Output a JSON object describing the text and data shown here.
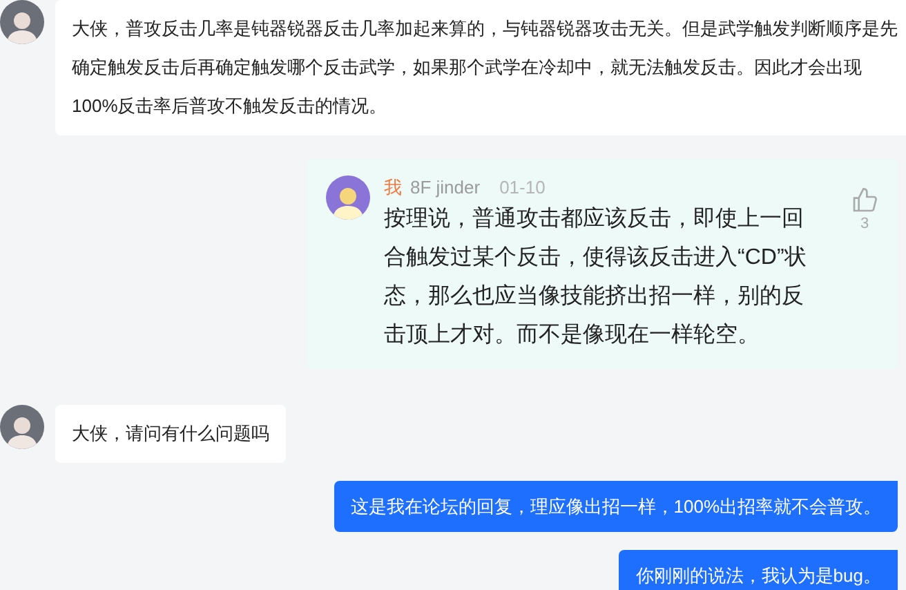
{
  "messages": [
    {
      "kind": "npc",
      "text": "大侠，普攻反击几率是钝器锐器反击几率加起来算的，与钝器锐器攻击无关。但是武学触发判断顺序是先确定触发反击后再确定触发哪个反击武学，如果那个武学在冷却中，就无法触发反击。因此才会出现100%反击率后普攻不触发反击的情况。"
    },
    {
      "kind": "post",
      "author": "我",
      "floor": "8F jinder",
      "date": "01-10",
      "likes": "3",
      "text": "按理说，普通攻击都应该反击，即使上一回合触发过某个反击，使得该反击进入“CD”状态，那么也应当像技能挤出招一样，别的反击顶上才对。而不是像现在一样轮空。"
    },
    {
      "kind": "npc",
      "text": "大侠，请问有什么问题吗"
    },
    {
      "kind": "user",
      "text": "这是我在论坛的回复，理应像出招一样，100%出招率就不会普攻。"
    },
    {
      "kind": "user",
      "text": "你刚刚的说法，我认为是bug。"
    }
  ]
}
